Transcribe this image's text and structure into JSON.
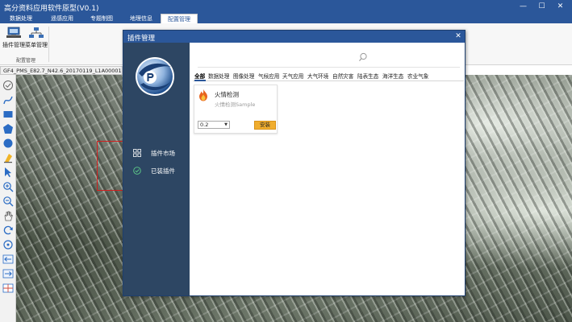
{
  "window": {
    "title": "高分资料应用软件原型(V0.1)",
    "minimize": "—",
    "maximize": "☐",
    "close": "✕"
  },
  "menu": {
    "tabs": [
      {
        "label": "数据处理"
      },
      {
        "label": "遥感应用"
      },
      {
        "label": "专题制图"
      },
      {
        "label": "地理信息"
      },
      {
        "label": "配置管理"
      }
    ],
    "active_index": 4
  },
  "ribbon": {
    "plugin_manage": "插件管理",
    "menu_manage": "菜单管理",
    "group_label": "配置管理"
  },
  "document_tab": "GF4_PMS_E82.7_N42.6_20170119_L1A0000154400",
  "dialog": {
    "title": "插件管理",
    "close": "✕",
    "sidebar": {
      "market": "插件市场",
      "installed": "已装插件"
    },
    "search": {
      "placeholder": ""
    },
    "categories": [
      {
        "label": "全部"
      },
      {
        "label": "数据处理"
      },
      {
        "label": "图像处理"
      },
      {
        "label": "气候应用"
      },
      {
        "label": "天气应用"
      },
      {
        "label": "大气环境"
      },
      {
        "label": "自然灾害"
      },
      {
        "label": "陆表生态"
      },
      {
        "label": "海洋生态"
      },
      {
        "label": "农业气象"
      }
    ],
    "plugin": {
      "name": "火情检测",
      "description": "火情检测Sample",
      "version": "0.2",
      "install": "安装"
    }
  },
  "colors": {
    "title_blue": "#2b579a",
    "sidebar_navy": "#2d4663",
    "install_orange": "#f0ad2e",
    "roi_red": "#d21e1e"
  }
}
